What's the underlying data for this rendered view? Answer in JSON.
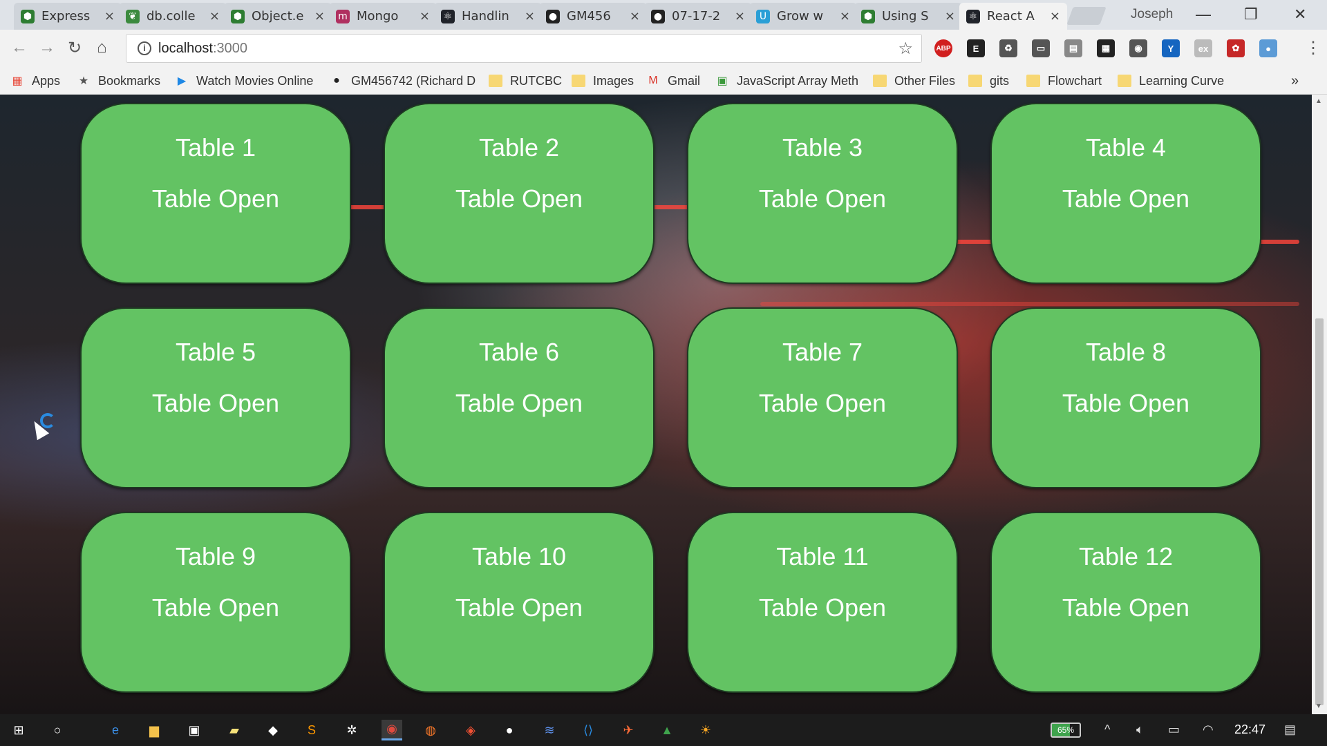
{
  "browser": {
    "tabs": [
      {
        "label": "Express",
        "icon": "node-icon",
        "color": "#2e7d32"
      },
      {
        "label": "db.colle",
        "icon": "mongodb-leaf-icon",
        "color": "#3b8a3e"
      },
      {
        "label": "Object.e",
        "icon": "node-icon",
        "color": "#2e7d32"
      },
      {
        "label": "Mongo",
        "icon": "m-logo-icon",
        "color": "#b03060"
      },
      {
        "label": "Handlin",
        "icon": "react-icon",
        "color": "#20232a"
      },
      {
        "label": "GM456",
        "icon": "github-icon",
        "color": "#222222"
      },
      {
        "label": "07-17-2",
        "icon": "github-icon",
        "color": "#222222"
      },
      {
        "label": "Grow w",
        "icon": "u-logo-icon",
        "color": "#2a9fd6"
      },
      {
        "label": "Using S",
        "icon": "node-icon",
        "color": "#2e7d32"
      },
      {
        "label": "React A",
        "icon": "react-icon",
        "color": "#20232a"
      }
    ],
    "profile_name": "Joseph",
    "url_host": "localhost",
    "url_port": ":3000",
    "extensions": [
      {
        "name": "adblock-icon",
        "text": "ABP",
        "color": "#d11f1f"
      },
      {
        "name": "evernote-icon",
        "text": "E",
        "color": "#222222"
      },
      {
        "name": "recycle-icon",
        "text": "♻",
        "color": "#555555"
      },
      {
        "name": "cast-icon",
        "text": "▭",
        "color": "#555555"
      },
      {
        "name": "reader-icon",
        "text": "▤",
        "color": "#888888"
      },
      {
        "name": "qr-code-icon",
        "text": "▦",
        "color": "#222222"
      },
      {
        "name": "globe-icon",
        "text": "◉",
        "color": "#555555"
      },
      {
        "name": "y-icon",
        "text": "Y",
        "color": "#1565c0"
      },
      {
        "name": "ex-icon",
        "text": "ex",
        "color": "#bbbbbb"
      },
      {
        "name": "paw-icon",
        "text": "✿",
        "color": "#c62828"
      },
      {
        "name": "avatar-icon",
        "text": "●",
        "color": "#5c9bd6"
      }
    ],
    "bookmarks": [
      {
        "label": "Apps",
        "icon": "apps-grid-icon"
      },
      {
        "label": "Bookmarks",
        "icon": "star-icon"
      },
      {
        "label": "Watch Movies Online",
        "icon": "play-circle-icon"
      },
      {
        "label": "GM456742 (Richard D",
        "icon": "github-icon"
      },
      {
        "label": "RUTCBC",
        "icon": "folder-icon"
      },
      {
        "label": "Images",
        "icon": "folder-icon"
      },
      {
        "label": "Gmail",
        "icon": "gmail-icon"
      },
      {
        "label": "JavaScript Array Meth",
        "icon": "page-icon"
      },
      {
        "label": "Other Files",
        "icon": "folder-icon"
      },
      {
        "label": "gits",
        "icon": "folder-icon"
      },
      {
        "label": "Flowchart",
        "icon": "folder-icon"
      },
      {
        "label": "Learning Curve",
        "icon": "folder-icon"
      }
    ],
    "bookmarks_overflow": "»"
  },
  "tables": [
    {
      "name": "Table 1",
      "status": "Table Open"
    },
    {
      "name": "Table 2",
      "status": "Table Open"
    },
    {
      "name": "Table 3",
      "status": "Table Open"
    },
    {
      "name": "Table 4",
      "status": "Table Open"
    },
    {
      "name": "Table 5",
      "status": "Table Open"
    },
    {
      "name": "Table 6",
      "status": "Table Open"
    },
    {
      "name": "Table 7",
      "status": "Table Open"
    },
    {
      "name": "Table 8",
      "status": "Table Open"
    },
    {
      "name": "Table 9",
      "status": "Table Open"
    },
    {
      "name": "Table 10",
      "status": "Table Open"
    },
    {
      "name": "Table 11",
      "status": "Table Open"
    },
    {
      "name": "Table 12",
      "status": "Table Open"
    }
  ],
  "colors": {
    "card_green": "#63c363",
    "card_border": "#1e3a22"
  },
  "taskbar": {
    "apps": [
      "windows-start-icon",
      "cortana-icon",
      "edge-icon",
      "file-explorer-icon",
      "cod-game-icon",
      "sticky-notes-icon",
      "notes-icon",
      "sublime-icon",
      "slack-icon",
      "chrome-icon",
      "firefox-icon",
      "git-icon",
      "github-desktop-icon",
      "sql-icon",
      "vscode-icon",
      "postman-icon",
      "kraken-icon",
      "sun-app-icon"
    ],
    "battery_percent": "65%",
    "clock": "22:47"
  }
}
